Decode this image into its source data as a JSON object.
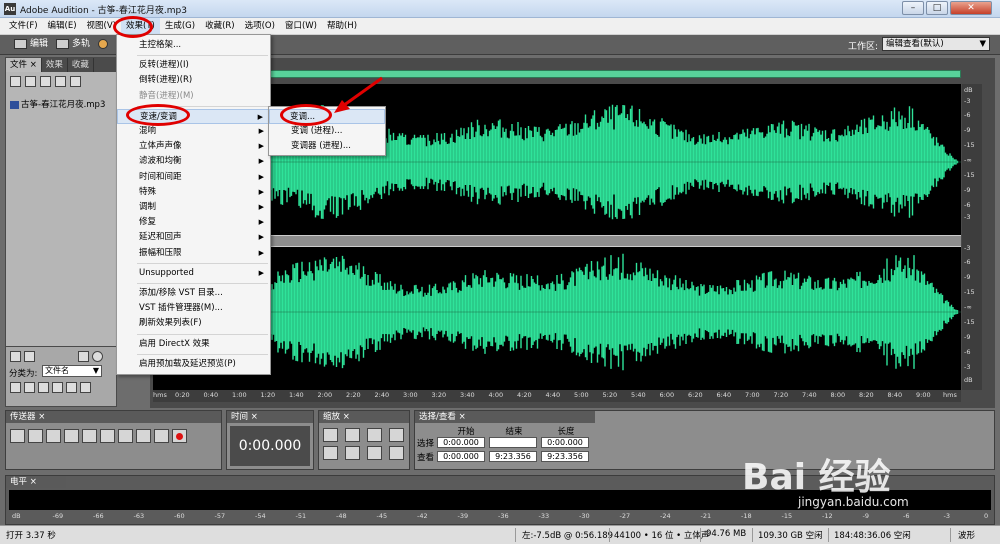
{
  "title_bar": {
    "icon_text": "Au",
    "title": "Adobe Audition - 古筝-春江花月夜.mp3",
    "min": "–",
    "max": "□",
    "close": "✕"
  },
  "menubar": {
    "items": [
      "文件(F)",
      "编辑(E)",
      "视图(V)",
      "效果(T)",
      "生成(G)",
      "收藏(R)",
      "选项(O)",
      "窗口(W)",
      "帮助(H)"
    ]
  },
  "toolbar": {
    "edit": "编辑",
    "multitrack": "多轨",
    "workspace_label": "工作区:",
    "workspace_value": "编辑查看(默认)"
  },
  "left_panel": {
    "tabs": [
      "文件",
      "效果",
      "收藏"
    ],
    "file_item": "古筝-春江花月夜.mp3",
    "sort_label": "分类为:",
    "sort_value": "文件名"
  },
  "effects_menu": {
    "items": [
      {
        "label": "主控格架...",
        "arrow": false,
        "disabled": false
      },
      {
        "label": "反转(进程)(I)",
        "arrow": false,
        "disabled": false
      },
      {
        "label": "倒转(进程)(R)",
        "arrow": false,
        "disabled": false
      },
      {
        "label": "静音(进程)(M)",
        "arrow": false,
        "disabled": true
      },
      {
        "label": "变速/变调",
        "arrow": true,
        "disabled": false
      },
      {
        "label": "混响",
        "arrow": true,
        "disabled": false
      },
      {
        "label": "立体声声像",
        "arrow": true,
        "disabled": false
      },
      {
        "label": "滤波和均衡",
        "arrow": true,
        "disabled": false
      },
      {
        "label": "时间和间距",
        "arrow": true,
        "disabled": false
      },
      {
        "label": "特殊",
        "arrow": true,
        "disabled": false
      },
      {
        "label": "调制",
        "arrow": true,
        "disabled": false
      },
      {
        "label": "修复",
        "arrow": true,
        "disabled": false
      },
      {
        "label": "延迟和回声",
        "arrow": true,
        "disabled": false
      },
      {
        "label": "振幅和压限",
        "arrow": true,
        "disabled": false
      },
      {
        "label": "Unsupported",
        "arrow": true,
        "disabled": false
      },
      {
        "label": "添加/移除 VST 目录...",
        "arrow": false,
        "disabled": false
      },
      {
        "label": "VST 插件管理器(M)...",
        "arrow": false,
        "disabled": false
      },
      {
        "label": "刷新效果列表(F)",
        "arrow": false,
        "disabled": false
      },
      {
        "label": "启用 DirectX 效果",
        "arrow": false,
        "disabled": false
      },
      {
        "label": "启用预加载及延迟预览(P)",
        "arrow": false,
        "disabled": false
      }
    ],
    "arrow_glyph": "▶"
  },
  "submenu": {
    "items": [
      "变调...",
      "变调 (进程)...",
      "变调器 (进程)..."
    ]
  },
  "db_scale": {
    "top": [
      "dB",
      "-3",
      "-6",
      "-9",
      "-15",
      "-∞",
      "-15",
      "-9",
      "-6",
      "-3"
    ],
    "bottom": [
      "-3",
      "-6",
      "-9",
      "-15",
      "-∞",
      "-15",
      "-9",
      "-6",
      "-3",
      "dB"
    ]
  },
  "time_ruler": {
    "labels": [
      "hms",
      "0:20",
      "0:40",
      "1:00",
      "1:20",
      "1:40",
      "2:00",
      "2:20",
      "2:40",
      "3:00",
      "3:20",
      "3:40",
      "4:00",
      "4:20",
      "4:40",
      "5:00",
      "5:20",
      "5:40",
      "6:00",
      "6:20",
      "6:40",
      "7:00",
      "7:20",
      "7:40",
      "8:00",
      "8:20",
      "8:40",
      "9:00",
      "hms"
    ]
  },
  "transport": {
    "title": "传送器",
    "close": "×"
  },
  "time_panel": {
    "title": "时间",
    "close": "×",
    "value": "0:00.000"
  },
  "zoom_panel": {
    "title": "缩放",
    "close": "×"
  },
  "selection_panel": {
    "title": "选择/查看",
    "close": "×",
    "col_start": "开始",
    "col_end": "结束",
    "col_length": "长度",
    "row_select": "选择",
    "row_view": "查看",
    "select_start": "0:00.000",
    "select_end": "",
    "select_length": "0:00.000",
    "view_start": "0:00.000",
    "view_end": "9:23.356",
    "view_length": "9:23.356"
  },
  "level_panel": {
    "title": "电平",
    "close": "×",
    "labels": [
      "dB",
      "-69",
      "-66",
      "-63",
      "-60",
      "-57",
      "-54",
      "-51",
      "-48",
      "-45",
      "-42",
      "-39",
      "-36",
      "-33",
      "-30",
      "-27",
      "-24",
      "-21",
      "-18",
      "-15",
      "-12",
      "-9",
      "-6",
      "-3",
      "0"
    ]
  },
  "status_bar": {
    "left": "打开 3.37 秒",
    "pos": "左:-7.5dB @  0:56.189",
    "format": "44100 • 16 位 • 立体声",
    "size": "94.76 MB",
    "free": "109.30 GB 空闲",
    "time_free": "184:48:36.06 空闲",
    "mode": "波形"
  },
  "watermark": {
    "logo": "Bai 经验",
    "site": "jingyan.baidu.com"
  },
  "colors": {
    "waveform": "#2fe39a",
    "background": "#000000",
    "highlight_ring": "#e00000"
  }
}
